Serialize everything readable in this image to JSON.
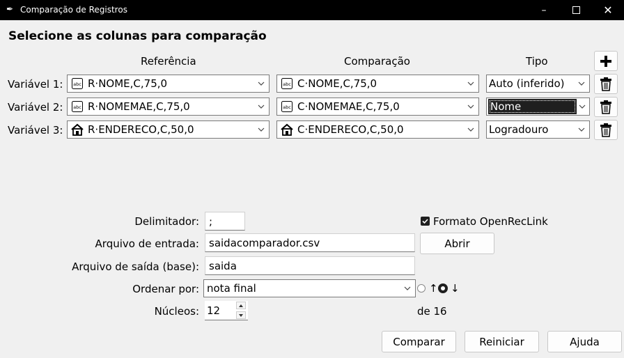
{
  "window": {
    "title": "Comparação de Registros"
  },
  "heading": "Selecione as colunas para comparação",
  "columns": {
    "referencia": "Referência",
    "comparacao": "Comparação",
    "tipo": "Tipo"
  },
  "rows": [
    {
      "label": "Variável 1:",
      "ref": "R·NOME,C,75,0",
      "comp": "C·NOME,C,75,0",
      "tipo": "Auto (inferido)",
      "ref_icon": "abc-icon",
      "comp_icon": "abc-icon"
    },
    {
      "label": "Variável 2:",
      "ref": "R·NOMEMAE,C,75,0",
      "comp": "C·NOMEMAE,C,75,0",
      "tipo": "Nome",
      "ref_icon": "abc-icon",
      "comp_icon": "abc-icon"
    },
    {
      "label": "Variável 3:",
      "ref": "R·ENDERECO,C,50,0",
      "comp": "C·ENDERECO,C,50,0",
      "tipo": "Logradouro",
      "ref_icon": "house-icon",
      "comp_icon": "house-icon"
    }
  ],
  "form": {
    "delimiter_label": "Delimitador:",
    "delimiter_value": ";",
    "openreclink_label": "Formato OpenRecLink",
    "openreclink_checked": true,
    "input_label": "Arquivo de entrada:",
    "input_value": "saidacomparador.csv",
    "open_button": "Abrir",
    "output_label": "Arquivo de saída (base):",
    "output_value": "saida",
    "sort_label": "Ordenar por:",
    "sort_value": "nota final",
    "asc_symbol": "↑",
    "desc_symbol": "↓",
    "sort_direction": "desc",
    "cores_label": "Núcleos:",
    "cores_value": "12",
    "cores_total": "de 16"
  },
  "buttons": {
    "compare": "Comparar",
    "reset": "Reiniciar",
    "help": "Ajuda"
  }
}
